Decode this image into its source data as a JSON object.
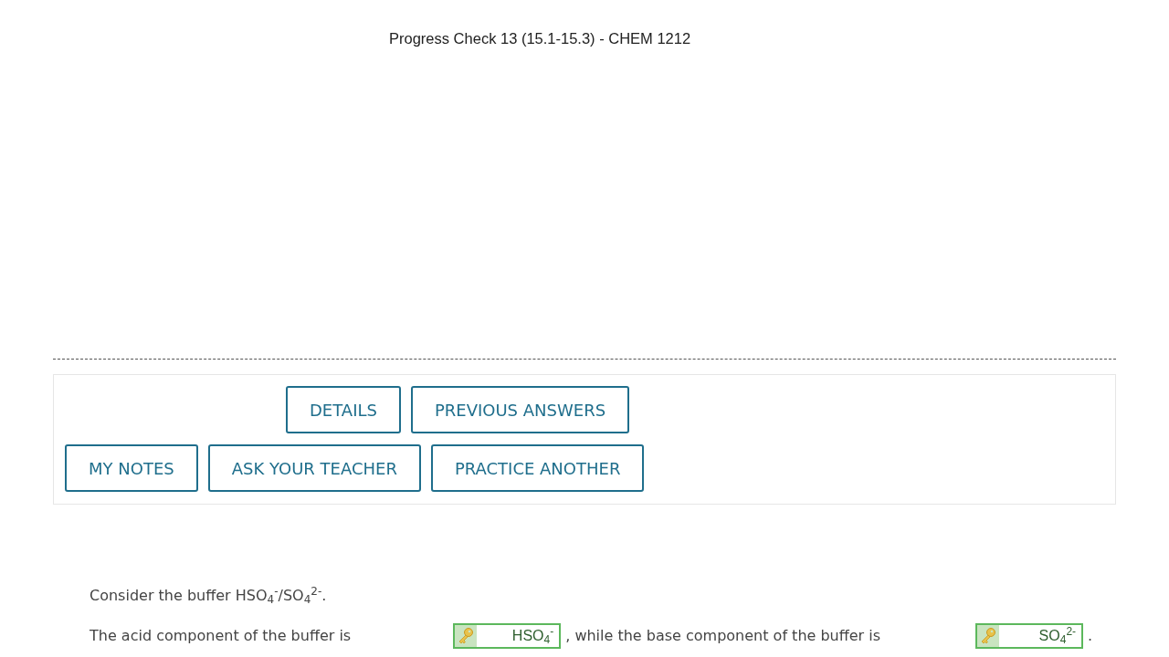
{
  "window": {
    "title": "Progress Check 13 (15.1-15.3) - CHEM 1212"
  },
  "toolbar": {
    "upper_buttons": [
      {
        "label": "DETAILS"
      },
      {
        "label": "PREVIOUS ANSWERS"
      }
    ],
    "lower_buttons": [
      {
        "label": "MY NOTES"
      },
      {
        "label": "ASK YOUR TEACHER"
      },
      {
        "label": "PRACTICE ANOTHER"
      }
    ]
  },
  "question": {
    "prompt": "Consider the buffer HSO$_{4}$$^{-}$/SO$_{4}$$^{2-}$.",
    "parts": [
      {
        "kind": "text",
        "text": "The acid component of the buffer is"
      },
      {
        "kind": "answer",
        "value": "HSO$_{4}$$^{-}$",
        "correct": true
      },
      {
        "kind": "text",
        "text": ", while the base component of the buffer is"
      },
      {
        "kind": "answer",
        "value": "SO$_{4}$$^{2-}$",
        "correct": true
      },
      {
        "kind": "text",
        "text": "."
      }
    ]
  }
}
